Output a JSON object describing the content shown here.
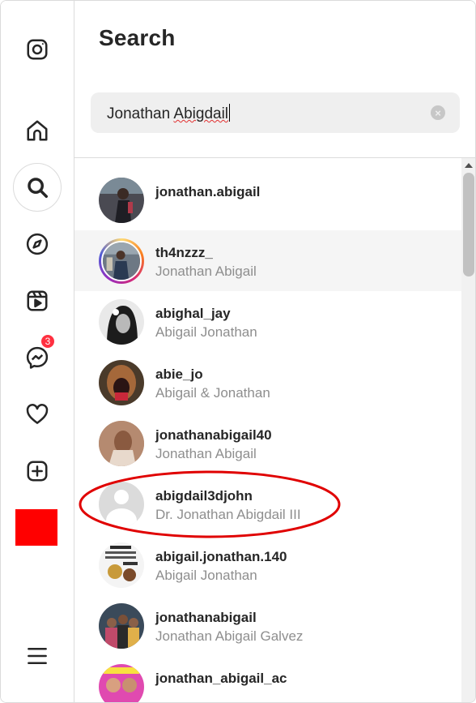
{
  "panel": {
    "title": "Search"
  },
  "search": {
    "value_first": "Jonathan ",
    "value_second": "Abigdail"
  },
  "sidebar": {
    "messages_badge": "3"
  },
  "results": [
    {
      "username": "jonathan.abigail",
      "fullname": ""
    },
    {
      "username": "th4nzzz_",
      "fullname": "Jonathan Abigail"
    },
    {
      "username": "abighal_jay",
      "fullname": "Abigail Jonathan"
    },
    {
      "username": "abie_jo",
      "fullname": "Abigail & Jonathan"
    },
    {
      "username": "jonathanabigail40",
      "fullname": "Jonathan Abigail"
    },
    {
      "username": "abigdail3djohn",
      "fullname": "Dr. Jonathan Abigdail III"
    },
    {
      "username": "abigail.jonathan.140",
      "fullname": "Abigail Jonathan"
    },
    {
      "username": "jonathanabigail",
      "fullname": "Jonathan Abigail Galvez"
    },
    {
      "username": "jonathan_abigail_ac",
      "fullname": ""
    }
  ],
  "colors": {
    "badge": "#ff3040",
    "annotation": "#e00000",
    "profile_placeholder": "#ff0000"
  },
  "icons": [
    "instagram-icon",
    "home-icon",
    "search-icon",
    "explore-icon",
    "reels-icon",
    "messenger-icon",
    "heart-icon",
    "create-icon",
    "menu-icon",
    "clear-icon"
  ]
}
